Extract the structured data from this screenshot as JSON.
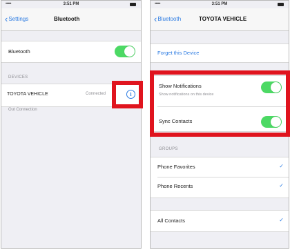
{
  "left": {
    "status": {
      "carrier": "•••••",
      "time": "3:51 PM"
    },
    "nav": {
      "back": "Settings",
      "title": "Bluetooth"
    },
    "bluetooth_label": "Bluetooth",
    "devices_header": "DEVICES",
    "device_name": "TOYOTA VEHICLE",
    "device_status": "Connected",
    "device_sub": "Out Connection"
  },
  "right": {
    "status": {
      "carrier": "•••••",
      "time": "3:51 PM"
    },
    "nav": {
      "back": "Bluetooth",
      "title": "TOYOTA VEHICLE"
    },
    "forget": "Forget this Device",
    "show_notifications": "Show Notifications",
    "show_notifications_sub": "Show notifications on this device",
    "sync_contacts": "Sync Contacts",
    "groups_header": "GROUPS",
    "phone_favorites": "Phone Favorites",
    "phone_recents": "Phone Recents",
    "all_contacts": "All Contacts"
  },
  "colors": {
    "highlight": "#e0141e",
    "toggle_on": "#4cd964",
    "link": "#2a7ae2"
  }
}
